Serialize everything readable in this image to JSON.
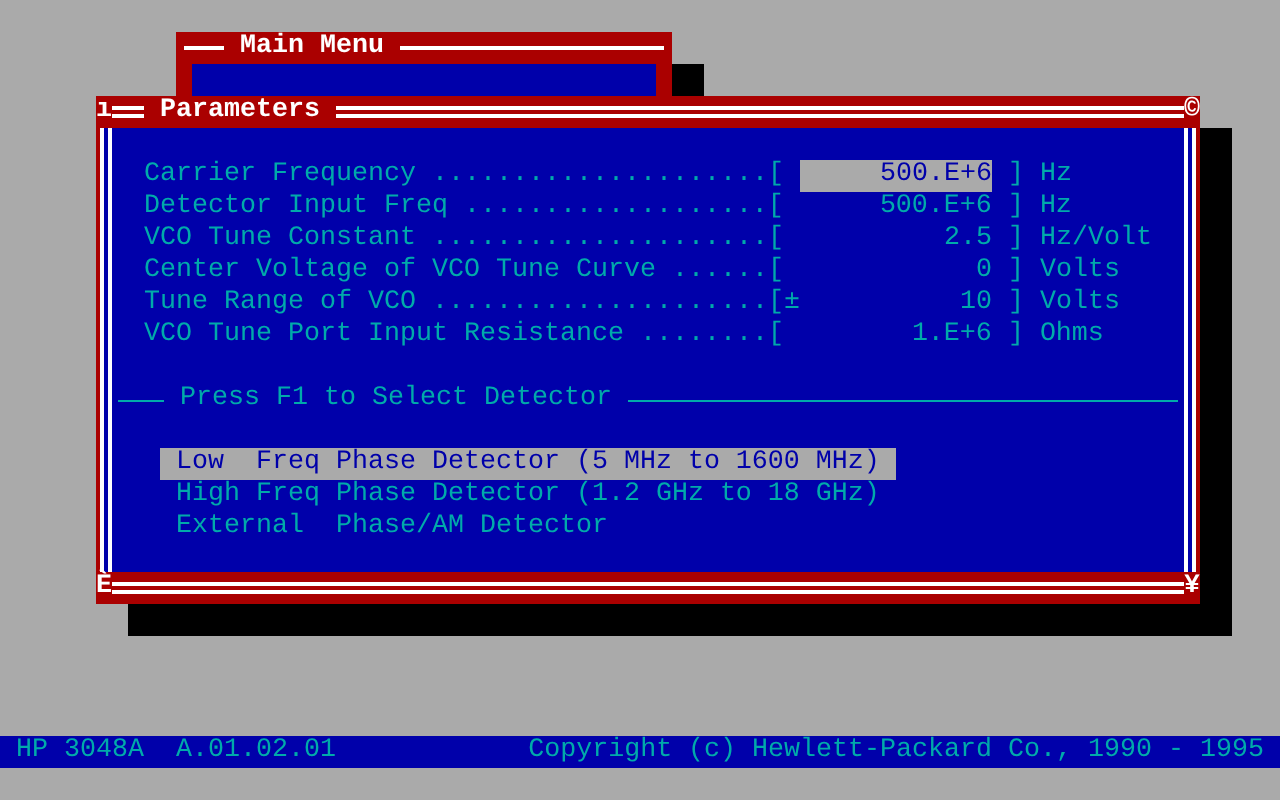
{
  "main_menu": {
    "title": "Main Menu"
  },
  "parameters": {
    "title": "Parameters",
    "corners": {
      "top_left": "ı",
      "top_right": "©",
      "bottom_left": "È",
      "bottom_right": "¥"
    },
    "fields": [
      {
        "label": "Carrier Frequency",
        "leader": ".....................[",
        "value": "500.E+6",
        "close": "]",
        "unit": "Hz",
        "selected": true
      },
      {
        "label": "Detector Input Freq",
        "leader": "...................[",
        "value": "500.E+6",
        "close": "]",
        "unit": "Hz",
        "selected": false
      },
      {
        "label": "VCO Tune Constant",
        "leader": ".....................[",
        "value": "2.5",
        "close": "]",
        "unit": "Hz/Volt",
        "selected": false
      },
      {
        "label": "Center Voltage of VCO Tune Curve",
        "leader": "......[",
        "value": "0",
        "close": "]",
        "unit": "Volts",
        "selected": false
      },
      {
        "label": "Tune Range of VCO",
        "leader": ".....................[",
        "sign": "±",
        "value": "10",
        "close": "]",
        "unit": "Volts",
        "selected": false
      },
      {
        "label": "VCO Tune Port Input Resistance",
        "leader": "........[",
        "value": "1.E+6",
        "close": "]",
        "unit": "Ohms",
        "selected": false
      }
    ],
    "section": {
      "title": "Press F1 to Select Detector"
    },
    "detectors": [
      {
        "label": "Low  Freq Phase Detector (5 MHz to 1600 MHz)",
        "selected": true
      },
      {
        "label": "High Freq Phase Detector (1.2 GHz to 18 GHz)",
        "selected": false
      },
      {
        "label": "External  Phase/AM Detector",
        "selected": false
      }
    ]
  },
  "status_bar": {
    "product": "HP 3048A",
    "version": "A.01.02.01",
    "copyright": "Copyright (c) Hewlett-Packard Co., 1990 - 1995"
  }
}
